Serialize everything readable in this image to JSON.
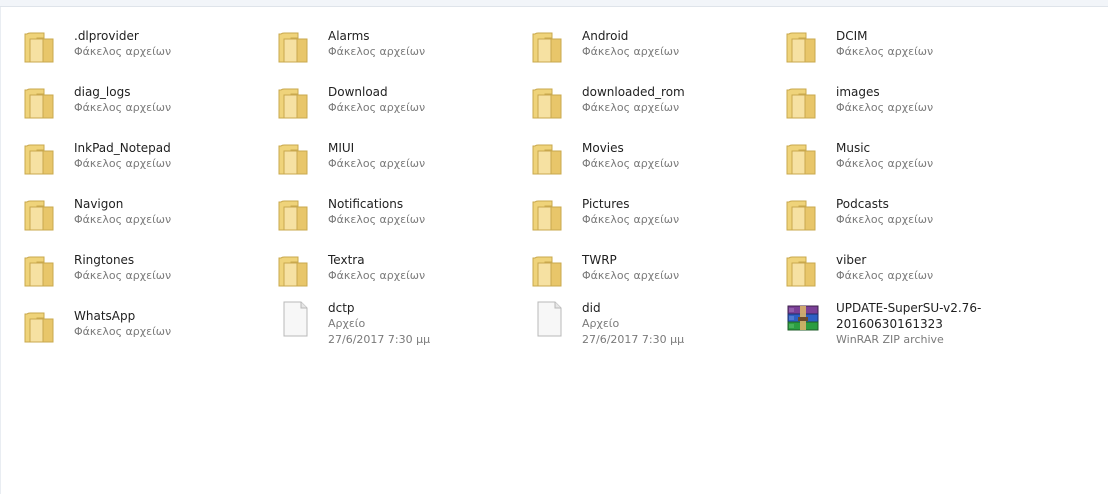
{
  "items": [
    {
      "name": ".dlprovider",
      "type": "Φάκελος αρχείων",
      "icon": "folder-icon"
    },
    {
      "name": "Alarms",
      "type": "Φάκελος αρχείων",
      "icon": "folder-icon"
    },
    {
      "name": "Android",
      "type": "Φάκελος αρχείων",
      "icon": "folder-icon"
    },
    {
      "name": "DCIM",
      "type": "Φάκελος αρχείων",
      "icon": "folder-icon"
    },
    {
      "name": "diag_logs",
      "type": "Φάκελος αρχείων",
      "icon": "folder-icon"
    },
    {
      "name": "Download",
      "type": "Φάκελος αρχείων",
      "icon": "folder-icon"
    },
    {
      "name": "downloaded_rom",
      "type": "Φάκελος αρχείων",
      "icon": "folder-icon"
    },
    {
      "name": "images",
      "type": "Φάκελος αρχείων",
      "icon": "folder-icon"
    },
    {
      "name": "InkPad_Notepad",
      "type": "Φάκελος αρχείων",
      "icon": "folder-icon"
    },
    {
      "name": "MIUI",
      "type": "Φάκελος αρχείων",
      "icon": "folder-icon"
    },
    {
      "name": "Movies",
      "type": "Φάκελος αρχείων",
      "icon": "folder-icon"
    },
    {
      "name": "Music",
      "type": "Φάκελος αρχείων",
      "icon": "folder-icon"
    },
    {
      "name": "Navigon",
      "type": "Φάκελος αρχείων",
      "icon": "folder-icon"
    },
    {
      "name": "Notifications",
      "type": "Φάκελος αρχείων",
      "icon": "folder-icon"
    },
    {
      "name": "Pictures",
      "type": "Φάκελος αρχείων",
      "icon": "folder-icon"
    },
    {
      "name": "Podcasts",
      "type": "Φάκελος αρχείων",
      "icon": "folder-icon"
    },
    {
      "name": "Ringtones",
      "type": "Φάκελος αρχείων",
      "icon": "folder-icon"
    },
    {
      "name": "Textra",
      "type": "Φάκελος αρχείων",
      "icon": "folder-icon"
    },
    {
      "name": "TWRP",
      "type": "Φάκελος αρχείων",
      "icon": "folder-icon"
    },
    {
      "name": "viber",
      "type": "Φάκελος αρχείων",
      "icon": "folder-icon"
    },
    {
      "name": "WhatsApp",
      "type": "Φάκελος αρχείων",
      "icon": "folder-icon"
    },
    {
      "name": "dctp",
      "type": "Αρχείο",
      "date": "27/6/2017 7:30 μμ",
      "icon": "file-icon"
    },
    {
      "name": "did",
      "type": "Αρχείο",
      "date": "27/6/2017 7:30 μμ",
      "icon": "file-icon"
    },
    {
      "name": "UPDATE-SuperSU-v2.76-20160630161323",
      "type": "WinRAR ZIP archive",
      "icon": "winrar-archive-icon"
    }
  ]
}
